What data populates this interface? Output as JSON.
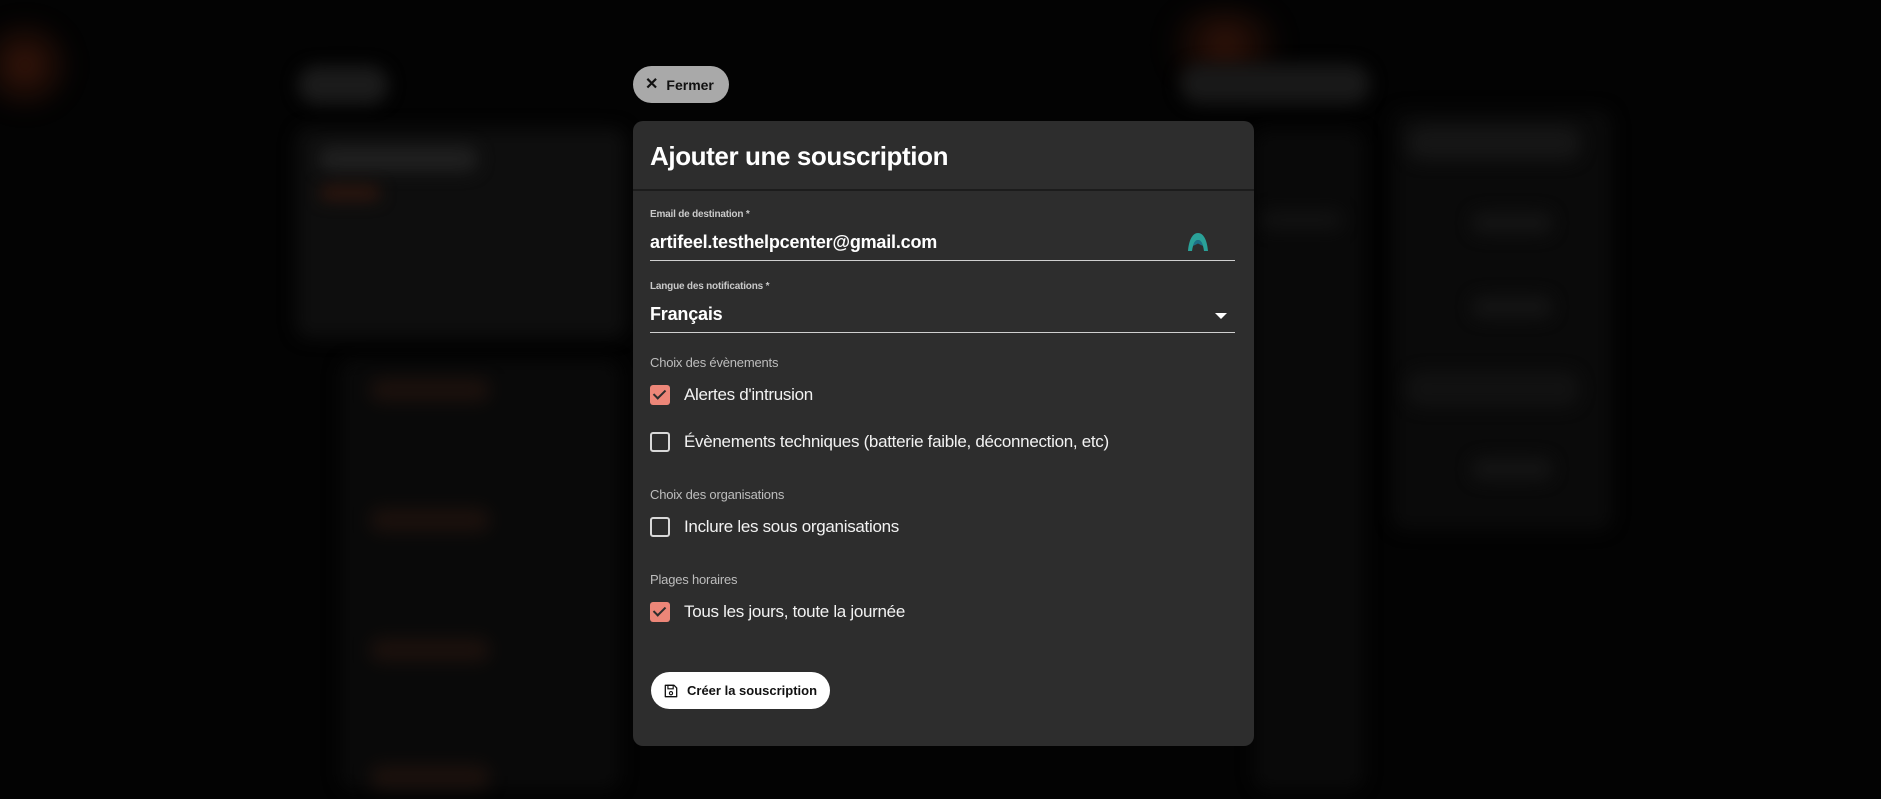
{
  "close_button": {
    "label": "Fermer",
    "icon": "close-icon"
  },
  "modal": {
    "title": "Ajouter une souscription",
    "email_field": {
      "label": "Email de destination *",
      "value": "artifeel.testhelpcenter@gmail.com",
      "icon": "extension-icon"
    },
    "language_field": {
      "label": "Langue des notifications *",
      "value": "Français",
      "icon": "chevron-down-icon"
    },
    "events_section": {
      "label": "Choix des évènements",
      "options": [
        {
          "label": "Alertes d'intrusion",
          "checked": true
        },
        {
          "label": "Évènements techniques (batterie faible, déconnection, etc)",
          "checked": false
        }
      ]
    },
    "organisations_section": {
      "label": "Choix des organisations",
      "options": [
        {
          "label": "Inclure les sous organisations",
          "checked": false
        }
      ]
    },
    "schedule_section": {
      "label": "Plages horaires",
      "options": [
        {
          "label": "Tous les jours, toute la journée",
          "checked": true
        }
      ]
    },
    "submit_button": {
      "label": "Créer la souscription",
      "icon": "save-icon"
    }
  },
  "colors": {
    "modal_bg": "#2d2d2d",
    "accent": "#ec8678",
    "close_pill": "#a9a9a9",
    "overlay_bg": "#050505"
  }
}
